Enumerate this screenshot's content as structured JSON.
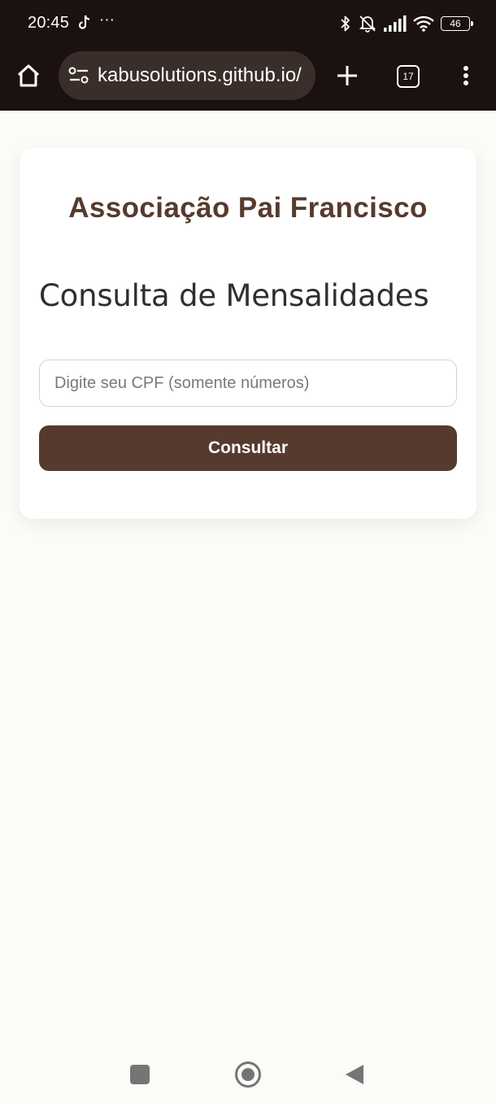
{
  "status_bar": {
    "time": "20:45",
    "overflow_indicator": "···",
    "battery_level": "46",
    "icons": [
      "tiktok-icon",
      "bluetooth-icon",
      "notifications-muted-icon",
      "signal-icon",
      "wifi-icon",
      "battery-icon"
    ]
  },
  "browser": {
    "url": "kabusolutions.github.io/",
    "tab_count": "17",
    "icons": [
      "home-icon",
      "site-settings-icon",
      "plus-icon",
      "tabs-icon",
      "more-vert-icon"
    ]
  },
  "page": {
    "org_title": "Associação Pai Francisco",
    "heading": "Consulta de Mensalidades",
    "cpf_placeholder": "Digite seu CPF (somente números)",
    "cpf_value": "",
    "submit_label": "Consultar"
  },
  "colors": {
    "chrome_background": "#1b1110",
    "url_pill": "#3a2e2b",
    "page_background": "#fcfbf8",
    "brand_brown": "#563a2d",
    "heading_text": "#2f2f2f"
  },
  "system_nav": {
    "icons": [
      "recents-square-icon",
      "home-circle-icon",
      "back-triangle-icon"
    ]
  }
}
